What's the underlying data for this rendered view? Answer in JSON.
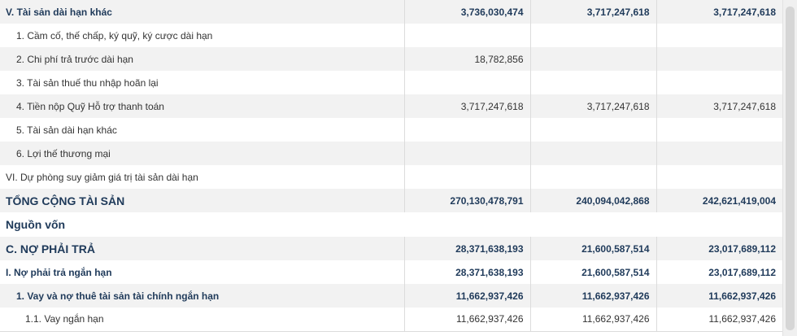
{
  "rows": [
    {
      "label": "V. Tài sản dài hạn khác",
      "v1": "3,736,030,474",
      "v2": "3,717,247,618",
      "v3": "3,717,247,618"
    },
    {
      "label": "1. Cầm cố, thế chấp, ký quỹ, ký cược dài hạn",
      "v1": "",
      "v2": "",
      "v3": ""
    },
    {
      "label": "2. Chi phí trả trước dài hạn",
      "v1": "18,782,856",
      "v2": "",
      "v3": ""
    },
    {
      "label": "3. Tài sản thuế thu nhập hoãn lại",
      "v1": "",
      "v2": "",
      "v3": ""
    },
    {
      "label": "4. Tiền nộp Quỹ Hỗ trợ thanh toán",
      "v1": "3,717,247,618",
      "v2": "3,717,247,618",
      "v3": "3,717,247,618"
    },
    {
      "label": "5. Tài sản dài hạn khác",
      "v1": "",
      "v2": "",
      "v3": ""
    },
    {
      "label": "6. Lợi thế thương mại",
      "v1": "",
      "v2": "",
      "v3": ""
    },
    {
      "label": "VI. Dự phòng suy giảm giá trị tài sản dài hạn",
      "v1": "",
      "v2": "",
      "v3": ""
    },
    {
      "label": "TỔNG CỘNG TÀI SẢN",
      "v1": "270,130,478,791",
      "v2": "240,094,042,868",
      "v3": "242,621,419,004"
    },
    {
      "label": "Nguồn vốn",
      "v1": "",
      "v2": "",
      "v3": ""
    },
    {
      "label": "C. NỢ PHẢI TRẢ",
      "v1": "28,371,638,193",
      "v2": "21,600,587,514",
      "v3": "23,017,689,112"
    },
    {
      "label": "I. Nợ phải trả ngắn hạn",
      "v1": "28,371,638,193",
      "v2": "21,600,587,514",
      "v3": "23,017,689,112"
    },
    {
      "label": "1. Vay và nợ thuê tài sản tài chính ngắn hạn",
      "v1": "11,662,937,426",
      "v2": "11,662,937,426",
      "v3": "11,662,937,426"
    },
    {
      "label": "1.1. Vay ngắn hạn",
      "v1": "11,662,937,426",
      "v2": "11,662,937,426",
      "v3": "11,662,937,426"
    }
  ]
}
